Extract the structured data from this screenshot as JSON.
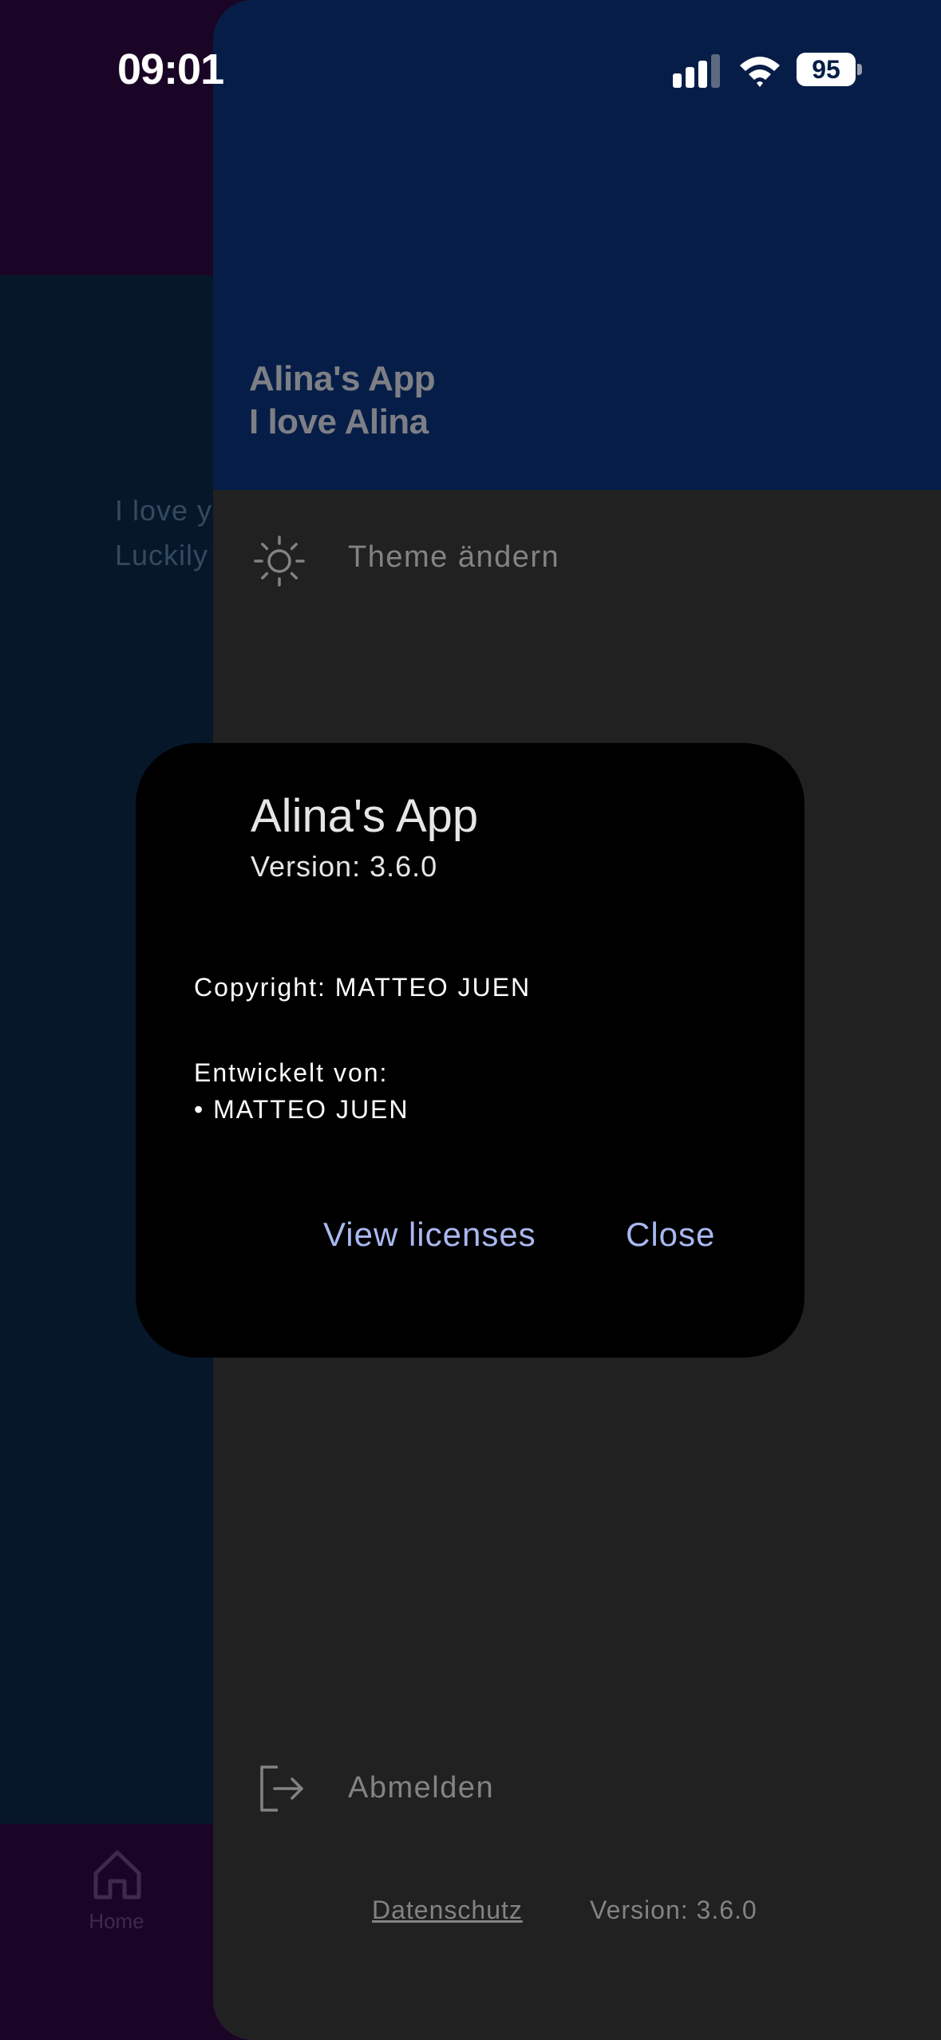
{
  "status_bar": {
    "time": "09:01",
    "battery": "95",
    "icons": [
      "signal-icon",
      "wifi-icon",
      "battery-icon"
    ]
  },
  "background": {
    "text": "I love y\nLuckily",
    "nav": {
      "home_label": "Home",
      "home_icon": "home-icon"
    }
  },
  "drawer": {
    "header": {
      "title": "Alina's App",
      "subtitle": "I love Alina"
    },
    "items": [
      {
        "label": "Theme ändern",
        "icon": "sun-icon"
      },
      {
        "label": "Abmelden",
        "icon": "logout-icon"
      }
    ],
    "footer": {
      "privacy": "Datenschutz",
      "version": "Version: 3.6.0"
    }
  },
  "dialog": {
    "title": "Alina's App",
    "version": "Version: 3.6.0",
    "copyright": "Copyright: MATTEO JUEN",
    "developed_by_label": "Entwickelt von:",
    "developers": [
      "• MATTEO JUEN"
    ],
    "view_licenses": "View licenses",
    "close": "Close"
  },
  "colors": {
    "drawer_header": "#061e47",
    "drawer_body": "#212121",
    "dialog_bg": "#000000",
    "accent_text": "#a9b8f0",
    "background_app": "#06172a",
    "background_bars": "#1b0527"
  }
}
